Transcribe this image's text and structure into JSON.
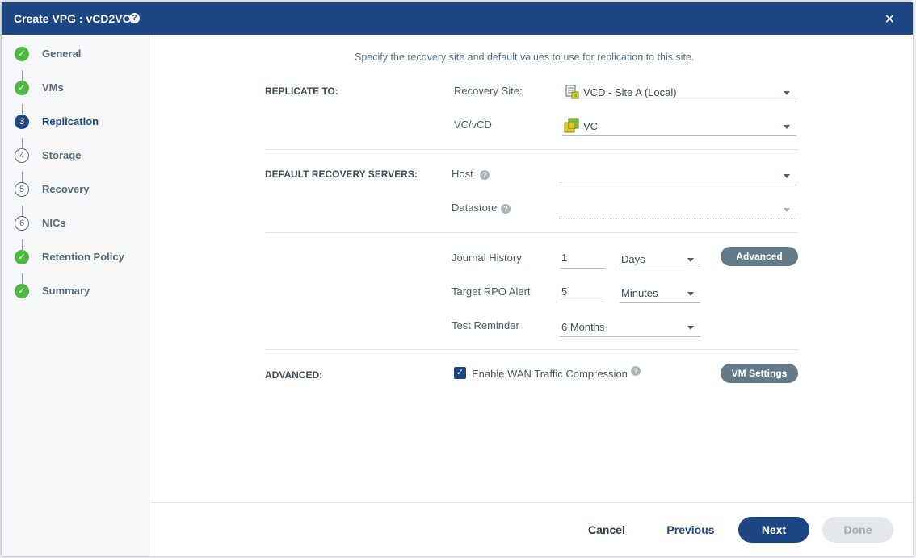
{
  "window": {
    "title": "Create VPG : vCD2VC",
    "help_icon": "question-circle-icon",
    "close_icon": "close-x-icon"
  },
  "steps": [
    {
      "number": "1",
      "label": "General",
      "state": "done"
    },
    {
      "number": "2",
      "label": "VMs",
      "state": "done"
    },
    {
      "number": "3",
      "label": "Replication",
      "state": "current"
    },
    {
      "number": "4",
      "label": "Storage",
      "state": "todo"
    },
    {
      "number": "5",
      "label": "Recovery",
      "state": "todo"
    },
    {
      "number": "6",
      "label": "NICs",
      "state": "todo"
    },
    {
      "number": "7",
      "label": "Retention Policy",
      "state": "done"
    },
    {
      "number": "8",
      "label": "Summary",
      "state": "done"
    }
  ],
  "intro": "Specify the recovery site and default values to use for replication to this site.",
  "replicate_to": {
    "section_label": "REPLICATE TO:",
    "recovery_site_label": "Recovery Site:",
    "recovery_site_value": "VCD - Site A (Local)",
    "vc_label": "VC/vCD",
    "vc_value": "VC"
  },
  "default_servers": {
    "section_label": "DEFAULT RECOVERY SERVERS:",
    "host_label": "Host",
    "host_value": "",
    "datastore_label": "Datastore",
    "datastore_value": ""
  },
  "journal": {
    "history_label": "Journal History",
    "history_value": "1",
    "history_unit": "Days",
    "advanced_button": "Advanced",
    "rpo_label": "Target RPO Alert",
    "rpo_value": "5",
    "rpo_unit": "Minutes",
    "test_label": "Test Reminder",
    "test_value": "6 Months"
  },
  "advanced": {
    "section_label": "ADVANCED:",
    "wan_label": "Enable WAN Traffic Compression",
    "wan_checked": true,
    "vm_settings_button": "VM Settings"
  },
  "footer": {
    "cancel": "Cancel",
    "previous": "Previous",
    "next": "Next",
    "done": "Done"
  },
  "colors": {
    "header": "#1d4784",
    "done_step": "#4fb842",
    "pill_button": "#637a88"
  }
}
